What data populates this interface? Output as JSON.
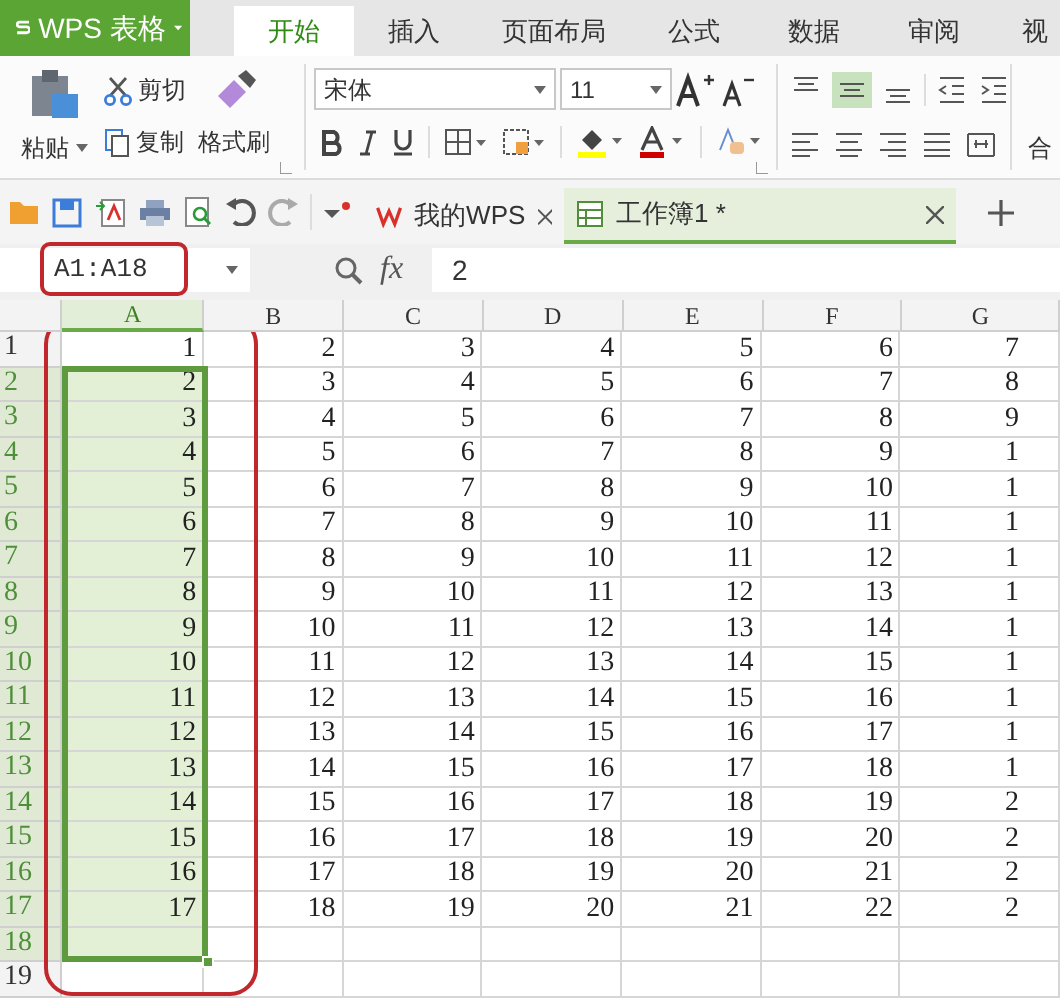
{
  "app": {
    "title": "WPS 表格"
  },
  "ribbon_tabs": [
    {
      "label": "开始",
      "selected": true
    },
    {
      "label": "插入",
      "selected": false
    },
    {
      "label": "页面布局",
      "selected": false
    },
    {
      "label": "公式",
      "selected": false
    },
    {
      "label": "数据",
      "selected": false
    },
    {
      "label": "审阅",
      "selected": false
    },
    {
      "label": "视",
      "selected": false
    }
  ],
  "clipboard": {
    "paste": "粘贴",
    "cut": "剪切",
    "copy": "复制",
    "format_painter": "格式刷"
  },
  "font": {
    "name": "宋体",
    "size": "11"
  },
  "alignment": {
    "merge": "合"
  },
  "doc_tabs": [
    {
      "label": "我的WPS",
      "selected": false
    },
    {
      "label": "工作簿1 *",
      "selected": true
    }
  ],
  "formula_bar": {
    "name_box": "A1:A18",
    "fx": "fx",
    "value": "2"
  },
  "sheet": {
    "columns": [
      {
        "label": "A",
        "selected": true
      },
      {
        "label": "B",
        "selected": false
      },
      {
        "label": "C",
        "selected": false
      },
      {
        "label": "D",
        "selected": false
      },
      {
        "label": "E",
        "selected": false
      },
      {
        "label": "F",
        "selected": false
      },
      {
        "label": "G",
        "selected": false
      }
    ],
    "rows": [
      {
        "label": "1",
        "selected": false,
        "cells": [
          "1",
          "2",
          "3",
          "4",
          "5",
          "6",
          "7"
        ]
      },
      {
        "label": "2",
        "selected": true,
        "cells": [
          "2",
          "3",
          "4",
          "5",
          "6",
          "7",
          "8"
        ]
      },
      {
        "label": "3",
        "selected": true,
        "cells": [
          "3",
          "4",
          "5",
          "6",
          "7",
          "8",
          "9"
        ]
      },
      {
        "label": "4",
        "selected": true,
        "cells": [
          "4",
          "5",
          "6",
          "7",
          "8",
          "9",
          "1"
        ]
      },
      {
        "label": "5",
        "selected": true,
        "cells": [
          "5",
          "6",
          "7",
          "8",
          "9",
          "10",
          "1"
        ]
      },
      {
        "label": "6",
        "selected": true,
        "cells": [
          "6",
          "7",
          "8",
          "9",
          "10",
          "11",
          "1"
        ]
      },
      {
        "label": "7",
        "selected": true,
        "cells": [
          "7",
          "8",
          "9",
          "10",
          "11",
          "12",
          "1"
        ]
      },
      {
        "label": "8",
        "selected": true,
        "cells": [
          "8",
          "9",
          "10",
          "11",
          "12",
          "13",
          "1"
        ]
      },
      {
        "label": "9",
        "selected": true,
        "cells": [
          "9",
          "10",
          "11",
          "12",
          "13",
          "14",
          "1"
        ]
      },
      {
        "label": "10",
        "selected": true,
        "cells": [
          "10",
          "11",
          "12",
          "13",
          "14",
          "15",
          "1"
        ]
      },
      {
        "label": "11",
        "selected": true,
        "cells": [
          "11",
          "12",
          "13",
          "14",
          "15",
          "16",
          "1"
        ]
      },
      {
        "label": "12",
        "selected": true,
        "cells": [
          "12",
          "13",
          "14",
          "15",
          "16",
          "17",
          "1"
        ]
      },
      {
        "label": "13",
        "selected": true,
        "cells": [
          "13",
          "14",
          "15",
          "16",
          "17",
          "18",
          "1"
        ]
      },
      {
        "label": "14",
        "selected": true,
        "cells": [
          "14",
          "15",
          "16",
          "17",
          "18",
          "19",
          "2"
        ]
      },
      {
        "label": "15",
        "selected": true,
        "cells": [
          "15",
          "16",
          "17",
          "18",
          "19",
          "20",
          "2"
        ]
      },
      {
        "label": "16",
        "selected": true,
        "cells": [
          "16",
          "17",
          "18",
          "19",
          "20",
          "21",
          "2"
        ]
      },
      {
        "label": "17",
        "selected": true,
        "cells": [
          "17",
          "18",
          "19",
          "20",
          "21",
          "22",
          "2"
        ]
      },
      {
        "label": "18",
        "selected": true
      },
      {
        "label": "19",
        "selected": false
      }
    ]
  }
}
